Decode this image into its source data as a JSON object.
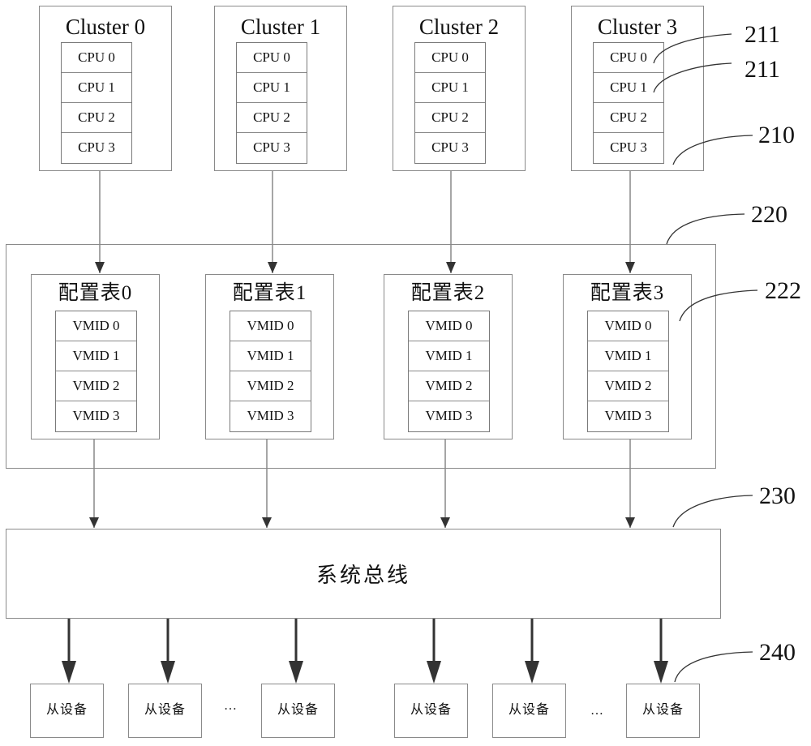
{
  "clusters": [
    {
      "title": "Cluster 0",
      "cpus": [
        "CPU 0",
        "CPU 1",
        "CPU 2",
        "CPU 3"
      ]
    },
    {
      "title": "Cluster 1",
      "cpus": [
        "CPU 0",
        "CPU 1",
        "CPU 2",
        "CPU 3"
      ]
    },
    {
      "title": "Cluster 2",
      "cpus": [
        "CPU 0",
        "CPU 1",
        "CPU 2",
        "CPU 3"
      ]
    },
    {
      "title": "Cluster 3",
      "cpus": [
        "CPU 0",
        "CPU 1",
        "CPU 2",
        "CPU 3"
      ]
    }
  ],
  "config_tables": [
    {
      "title": "配置表0",
      "vmids": [
        "VMID 0",
        "VMID 1",
        "VMID 2",
        "VMID 3"
      ]
    },
    {
      "title": "配置表1",
      "vmids": [
        "VMID 0",
        "VMID 1",
        "VMID 2",
        "VMID 3"
      ]
    },
    {
      "title": "配置表2",
      "vmids": [
        "VMID 0",
        "VMID 1",
        "VMID 2",
        "VMID 3"
      ]
    },
    {
      "title": "配置表3",
      "vmids": [
        "VMID 0",
        "VMID 1",
        "VMID 2",
        "VMID 3"
      ]
    }
  ],
  "bus": {
    "label": "系统总线"
  },
  "slaves": {
    "label": "从设备",
    "ellipsis": "…"
  },
  "reference_labels": {
    "cpu_0": "211",
    "cpu_1": "211",
    "cluster": "210",
    "config_module": "220",
    "config_table": "222",
    "bus": "230",
    "slave": "240"
  }
}
